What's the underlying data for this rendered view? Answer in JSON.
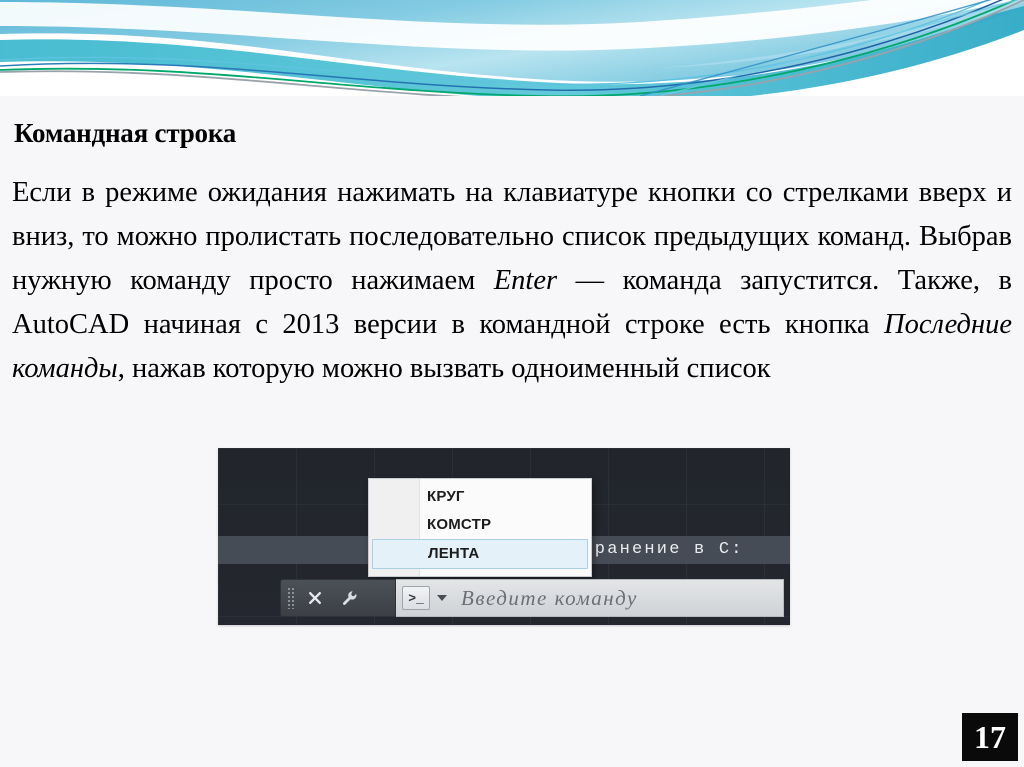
{
  "slide": {
    "title": "Командная строка",
    "page_number": "17",
    "background_color": "#f7f7f9",
    "body_paragraph_plain": "Если в режиме ожидания нажимать на клавиатуре кнопки со стрелками вверх и вниз, то можно пролистать последовательно список предыдущих команд. Выбрав нужную команду просто нажимаем Enter — команда запустится. Также, в AutoCAD начиная с 2013 версии в командной строке есть кнопка Последние команды, нажав которую можно вызвать одноименный список",
    "body_segments": [
      {
        "text": "Если в режиме ожидания нажимать на клавиатуре кнопки со стрелками вверх и вниз, то можно пролистать последовательно список предыдущих команд. Выбрав нужную команду просто нажимаем ",
        "italic": false
      },
      {
        "text": "Enter",
        "italic": true
      },
      {
        "text": " — команда запустится. Также, в AutoCAD начиная с 2013 версии в командной строке есть кнопка ",
        "italic": false
      },
      {
        "text": "Последние команды",
        "italic": true
      },
      {
        "text": ", нажав которую можно вызвать одноименный список",
        "italic": false
      }
    ]
  },
  "header_decoration": {
    "name": "wave-swoosh-banner",
    "colors": {
      "sky_top": "#7ec4e0",
      "sky_mid": "#a8dced",
      "teal": "#29b6c8",
      "green_line": "#00a86b",
      "blue_line": "#1a5fa8",
      "gray_line": "#9aa3ab",
      "white": "#ffffff"
    }
  },
  "autocad": {
    "canvas_color": "#24262e",
    "status_text": "охранение в С:",
    "dropdown": {
      "name": "recent-commands-dropdown",
      "items": [
        {
          "label": "КРУГ",
          "selected": false
        },
        {
          "label": "КОМСТР",
          "selected": false
        },
        {
          "label": "ЛЕНТА",
          "selected": true
        }
      ],
      "highlight_color": "#e4f1f8",
      "highlight_border": "#a9cfe4"
    },
    "command_bar": {
      "grip_name": "drag-grip",
      "close_label": "✕",
      "wrench_label": "Настройка",
      "prompt_symbol": ">_",
      "placeholder": "Введите команду"
    }
  }
}
